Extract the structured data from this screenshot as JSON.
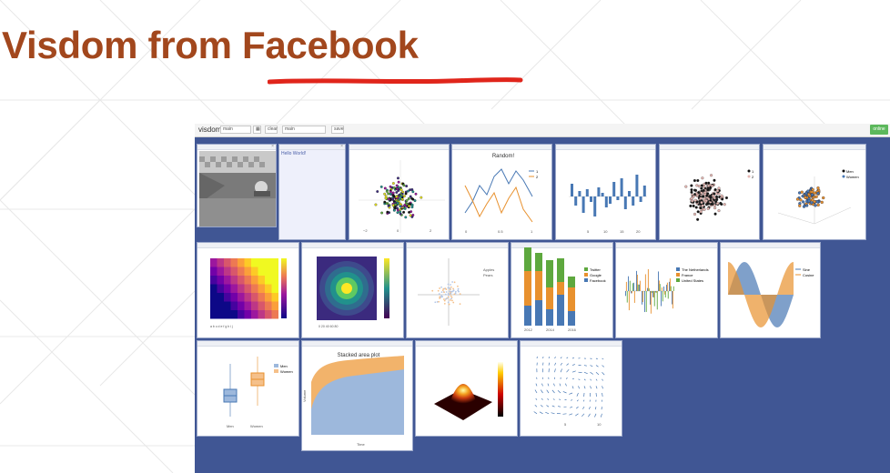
{
  "slide": {
    "title": "Visdom from Facebook"
  },
  "toolbar": {
    "brand": "visdom",
    "env_select": "main",
    "clear_button": "clear",
    "view_input": "main",
    "save_button": "save",
    "status": "online"
  },
  "panes": {
    "text": {
      "content": "Hello World!"
    },
    "line_random": {
      "title": "Random!",
      "legend": [
        "1",
        "2"
      ]
    },
    "scatter_men_women": {
      "legend": [
        "Men",
        "Women"
      ]
    },
    "scatter_apples": {
      "legend": [
        "Apples",
        "Pears"
      ]
    },
    "stacked_bar": {
      "legend": [
        "Twitter",
        "Google",
        "Facebook"
      ],
      "xticks": [
        "2012",
        "2014",
        "2016"
      ]
    },
    "grouped_bar": {
      "legend": [
        "The Netherlands",
        "France",
        "United States"
      ]
    },
    "sine": {
      "legend": [
        "Sine",
        "Cosine"
      ]
    },
    "boxplot": {
      "legend": [
        "Men",
        "Women"
      ],
      "xticks": [
        "Men",
        "Women"
      ]
    },
    "area": {
      "title": "Stacked area plot",
      "xlabel": "Time",
      "ylabel": "Volume"
    }
  },
  "colors": {
    "title": "#a2471d",
    "underline": "#e0251b",
    "background": "#405694",
    "online": "#5cb85c"
  }
}
